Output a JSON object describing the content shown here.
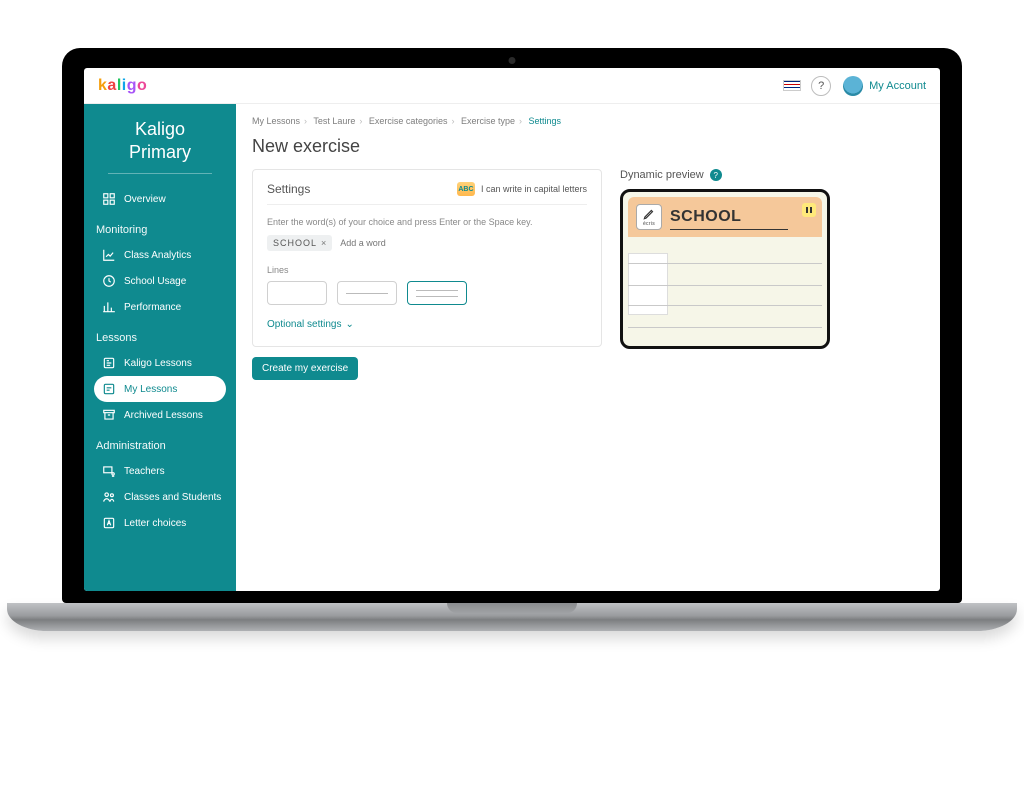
{
  "brand": {
    "name": "kaligo"
  },
  "header": {
    "help_label": "?",
    "account_label": "My Account",
    "language": "en-GB"
  },
  "sidebar": {
    "title_line1": "Kaligo",
    "title_line2": "Primary",
    "items": [
      {
        "section": null,
        "label": "Overview",
        "icon": "overview"
      },
      {
        "section": "Monitoring"
      },
      {
        "label": "Class Analytics",
        "icon": "chart"
      },
      {
        "label": "School Usage",
        "icon": "usage"
      },
      {
        "label": "Performance",
        "icon": "performance"
      },
      {
        "section": "Lessons"
      },
      {
        "label": "Kaligo Lessons",
        "icon": "kaligo-lessons"
      },
      {
        "label": "My Lessons",
        "icon": "my-lessons",
        "active": true
      },
      {
        "label": "Archived Lessons",
        "icon": "archive"
      },
      {
        "section": "Administration"
      },
      {
        "label": "Teachers",
        "icon": "teachers"
      },
      {
        "label": "Classes and Students",
        "icon": "classes"
      },
      {
        "label": "Letter choices",
        "icon": "letters"
      }
    ],
    "section_monitoring": "Monitoring",
    "section_lessons": "Lessons",
    "section_admin": "Administration",
    "overview": "Overview",
    "class_analytics": "Class Analytics",
    "school_usage": "School Usage",
    "performance": "Performance",
    "kaligo_lessons": "Kaligo Lessons",
    "my_lessons": "My Lessons",
    "archived_lessons": "Archived Lessons",
    "teachers": "Teachers",
    "classes_students": "Classes and Students",
    "letter_choices": "Letter choices"
  },
  "breadcrumbs": {
    "items": [
      "My Lessons",
      "Test Laure",
      "Exercise categories",
      "Exercise type",
      "Settings"
    ],
    "b1": "My Lessons",
    "b2": "Test Laure",
    "b3": "Exercise categories",
    "b4": "Exercise type",
    "b5": "Settings"
  },
  "page": {
    "title": "New exercise"
  },
  "settings": {
    "heading": "Settings",
    "capability_badge": "ABC",
    "capability_text": "I can write in capital letters",
    "word_hint": "Enter the word(s) of your choice and press Enter or the Space key.",
    "word_chip": "SCHOOL",
    "add_word_placeholder": "Add a word",
    "lines_label": "Lines",
    "line_options": [
      "none",
      "single",
      "double"
    ],
    "selected_line_option": "double",
    "optional_settings": "Optional settings"
  },
  "actions": {
    "create": "Create my exercise"
  },
  "preview": {
    "title": "Dynamic preview",
    "pencil_caption": "écris",
    "display_word": "SCHOOL"
  }
}
